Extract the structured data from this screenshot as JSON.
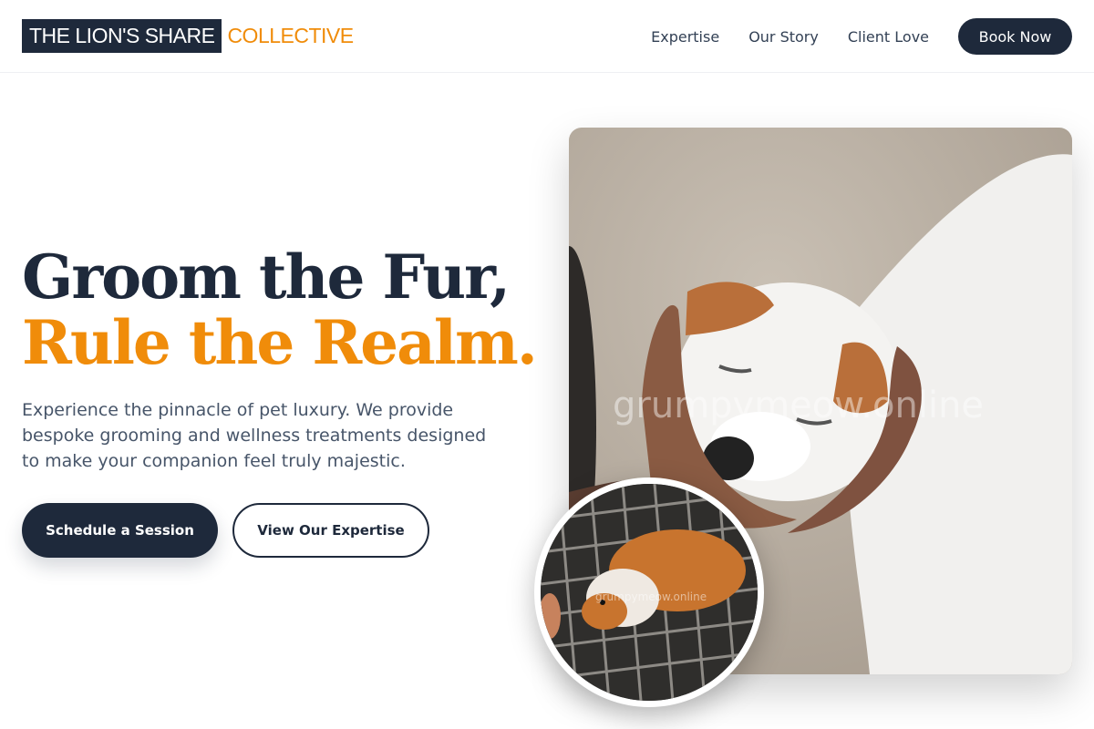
{
  "brand": {
    "main": "THE LION'S SHARE",
    "accent": "COLLECTIVE",
    "colors": {
      "primary": "#1e293b",
      "accent": "#f08c0a"
    }
  },
  "nav": {
    "items": [
      "Expertise",
      "Our Story",
      "Client Love"
    ],
    "cta_label": "Book Now"
  },
  "hero": {
    "headline_line1": "Groom the Fur,",
    "headline_line2": "Rule the Realm.",
    "description": "Experience the pinnacle of pet luxury. We provide bespoke grooming and wellness treatments designed to make your companion feel truly majestic.",
    "primary_button": "Schedule a Session",
    "secondary_button": "View Our Expertise"
  },
  "images": {
    "main_watermark": "grumpymeow.online",
    "inset_watermark": "grumpymeow.online"
  }
}
